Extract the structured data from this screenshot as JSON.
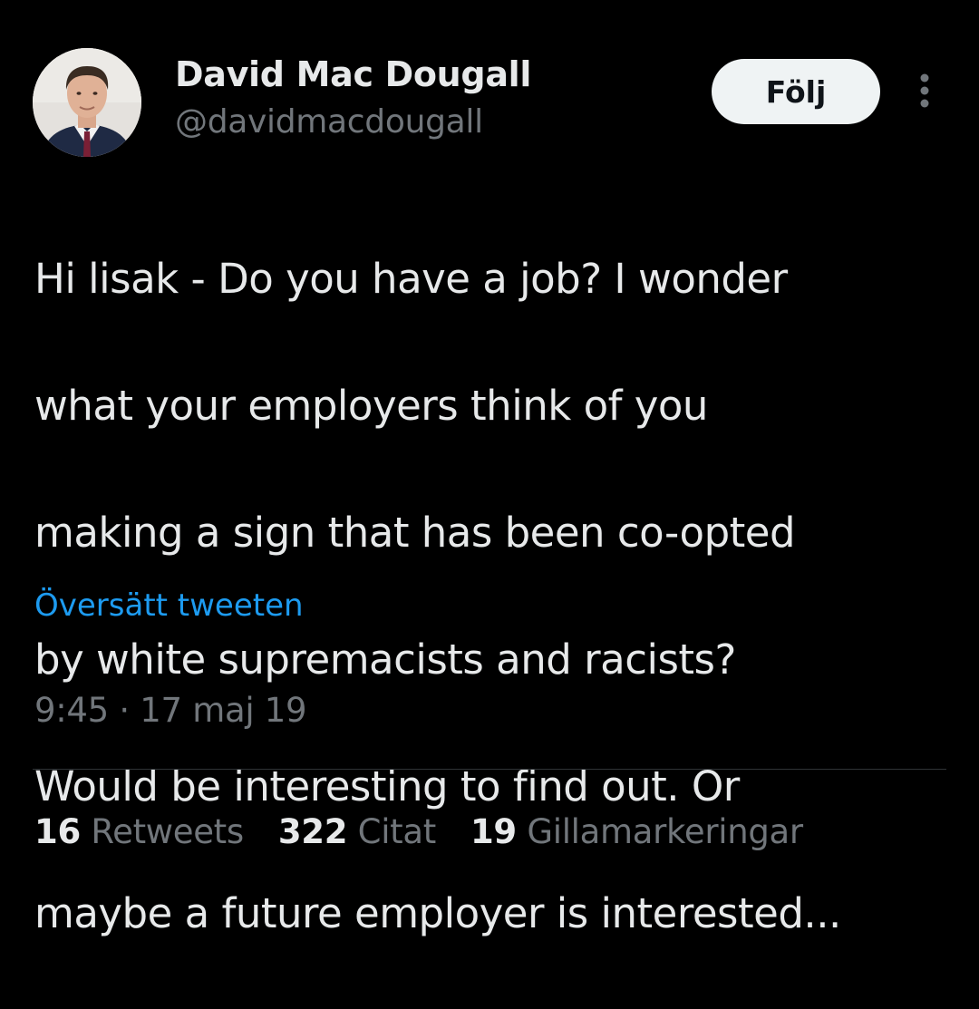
{
  "author": {
    "display_name": "David Mac Dougall",
    "handle": "@davidmacdougall",
    "avatar_icon": "profile-photo"
  },
  "header": {
    "follow_label": "Följ",
    "more_icon": "more-vertical-icon"
  },
  "tweet": {
    "text_lines": [
      "Hi lisak - Do you have a job? I wonder",
      "what your employers think of you",
      "making a sign that has been co-opted",
      "by white supremacists and racists?",
      "Would be interesting to find out. Or",
      "maybe a future employer is interested..."
    ],
    "translate_label": "Översätt tweeten",
    "timestamp": "9:45 · 17 maj 19"
  },
  "stats": [
    {
      "count": "16",
      "label": "Retweets"
    },
    {
      "count": "322",
      "label": "Citat"
    },
    {
      "count": "19",
      "label": "Gillamarkeringar"
    }
  ],
  "colors": {
    "background": "#000000",
    "text_primary": "#e7e9ea",
    "text_secondary": "#71767b",
    "link": "#1d9bf0",
    "button_bg": "#eff3f4",
    "divider": "#2f3336"
  }
}
